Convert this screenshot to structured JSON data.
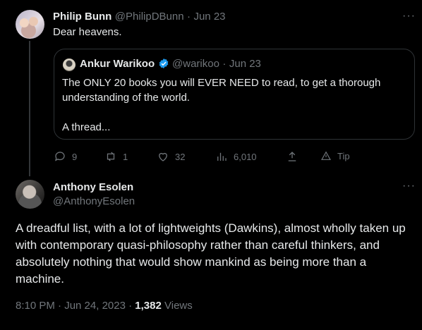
{
  "tweet1": {
    "name": "Philip Bunn",
    "handle": "@PhilipDBunn",
    "sep": "·",
    "date": "Jun 23",
    "text": "Dear heavens.",
    "more": "···"
  },
  "quote": {
    "name": "Ankur Warikoo",
    "handle": "@warikoo",
    "sep": "·",
    "date": "Jun 23",
    "text": "The ONLY 20 books you will EVER NEED to read, to get a thorough understanding of the world.\n\nA thread..."
  },
  "actions": {
    "replies": "9",
    "retweets": "1",
    "likes": "32",
    "views": "6,010",
    "tip": "Tip"
  },
  "tweet2": {
    "name": "Anthony Esolen",
    "handle": "@AnthonyEsolen",
    "more": "···",
    "text": "A dreadful list, with a lot of lightweights (Dawkins), almost wholly taken up with contemporary quasi-philosophy rather than careful thinkers, and absolutely nothing that would show mankind as being more than a machine.",
    "time": "8:10 PM · Jun 24, 2023 ·",
    "views_count": "1,382",
    "views_label": "Views"
  },
  "colors": {
    "background": "#000000",
    "text": "#e7e9ea",
    "muted": "#71767b",
    "verified": "#1d9bf0",
    "border": "#2f3336"
  },
  "icons": [
    "reply-icon",
    "retweet-icon",
    "like-icon",
    "views-icon",
    "share-icon",
    "tip-icon",
    "verified-badge-icon"
  ]
}
